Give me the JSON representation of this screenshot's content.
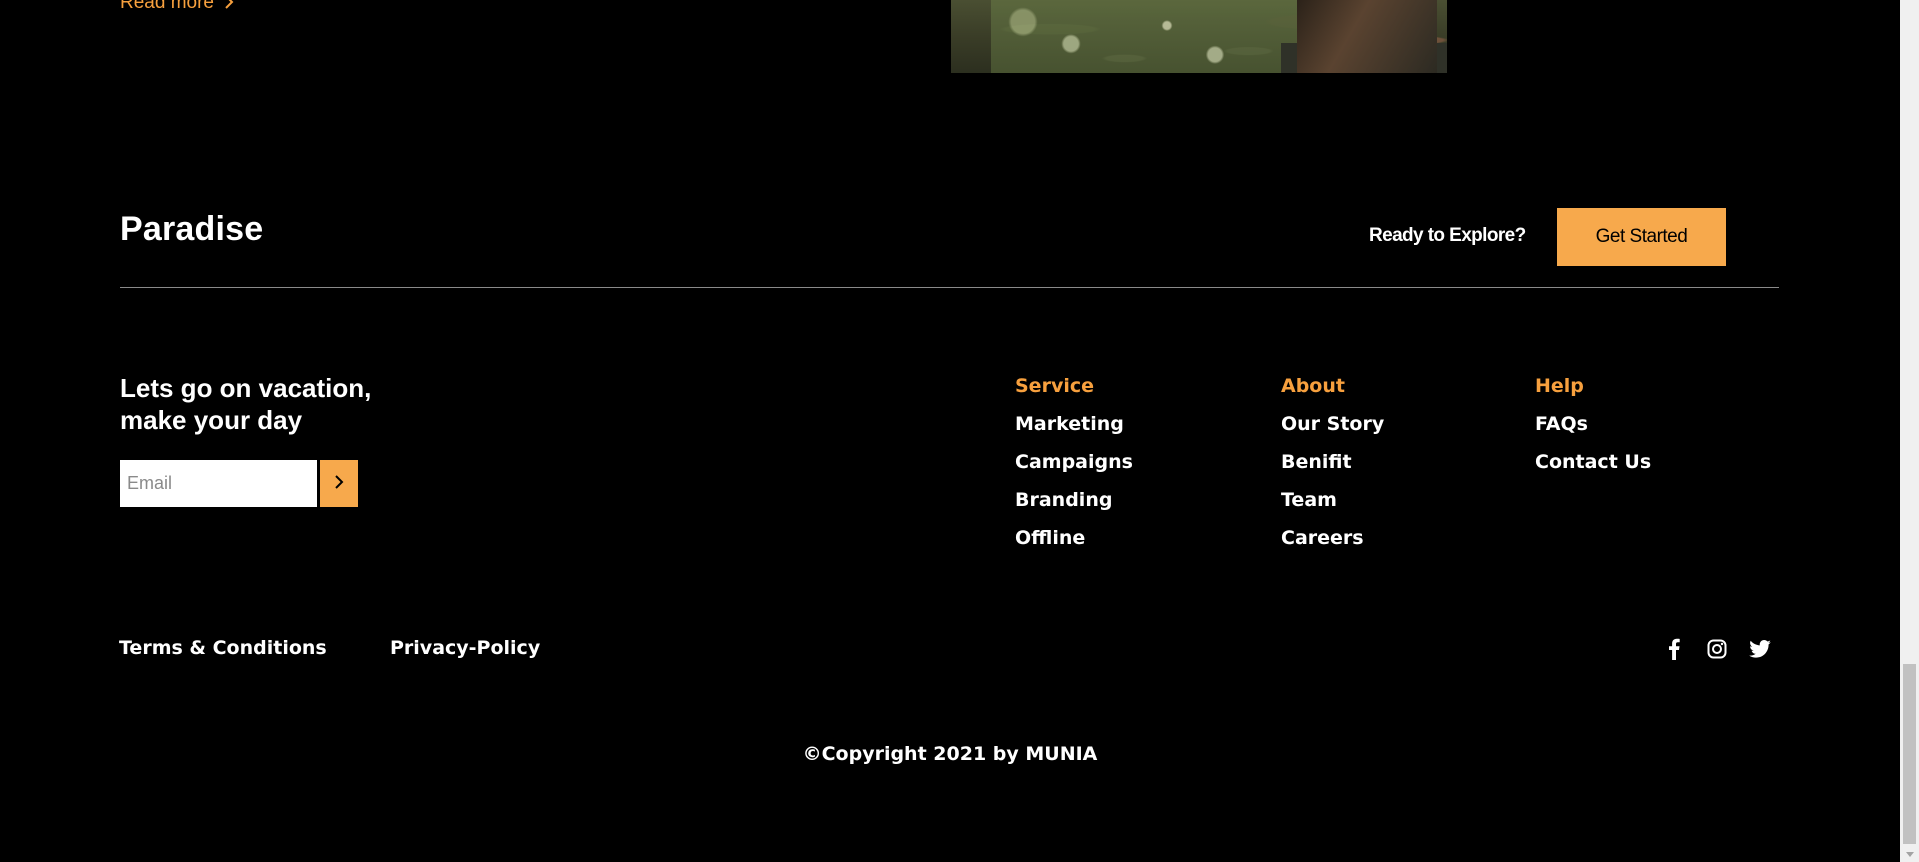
{
  "top": {
    "read_more_label": "Read more"
  },
  "footer": {
    "brand": "Paradise",
    "cta_prompt": "Ready to Explore?",
    "cta_button": "Get Started",
    "tagline": "Lets go on vacation, make your day",
    "email_placeholder": "Email",
    "columns": [
      {
        "heading": "Service",
        "links": [
          "Marketing",
          "Campaigns",
          "Branding",
          "Offline"
        ]
      },
      {
        "heading": "About",
        "links": [
          "Our Story",
          "Benifit",
          "Team",
          "Careers"
        ]
      },
      {
        "heading": "Help",
        "links": [
          "FAQs",
          "Contact Us"
        ]
      }
    ],
    "legal": {
      "terms": "Terms & Conditions",
      "privacy": "Privacy-Policy"
    },
    "socials": [
      "facebook-icon",
      "instagram-icon",
      "twitter-icon"
    ],
    "copyright": "©Copyright 2021 by MUNIA"
  },
  "colors": {
    "background": "#000000",
    "accent": "#f7a94c",
    "text": "#ffffff",
    "divider": "#8a8a8a"
  }
}
